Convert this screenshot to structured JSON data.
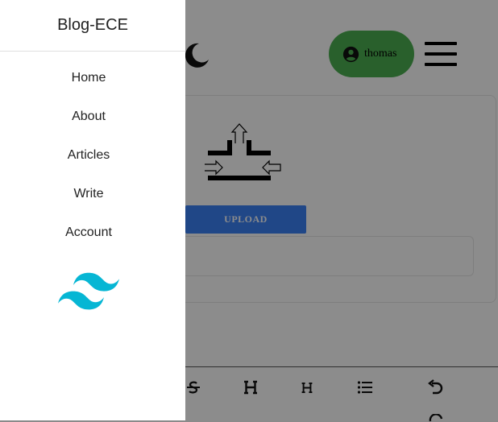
{
  "header": {
    "user_name": "thomas"
  },
  "upload": {
    "button_label": "UPLOAD"
  },
  "drawer": {
    "title": "Blog-ECE",
    "items": [
      {
        "label": "Home"
      },
      {
        "label": "About"
      },
      {
        "label": "Articles"
      },
      {
        "label": "Write"
      },
      {
        "label": "Account"
      }
    ]
  },
  "toolbar": {
    "tools": [
      "strikethrough",
      "heading-1",
      "heading-2",
      "bulleted-list",
      "undo",
      "redo"
    ]
  },
  "colors": {
    "user_pill": "#4caf50",
    "upload_button": "#3b82f6",
    "tailwind_logo": "#06b6d4",
    "overlay": "rgba(0,0,0,0.45)"
  },
  "icons": [
    "moon-icon",
    "account-circle-icon",
    "hamburger-menu-icon",
    "upload-illustration",
    "tailwind-logo"
  ]
}
